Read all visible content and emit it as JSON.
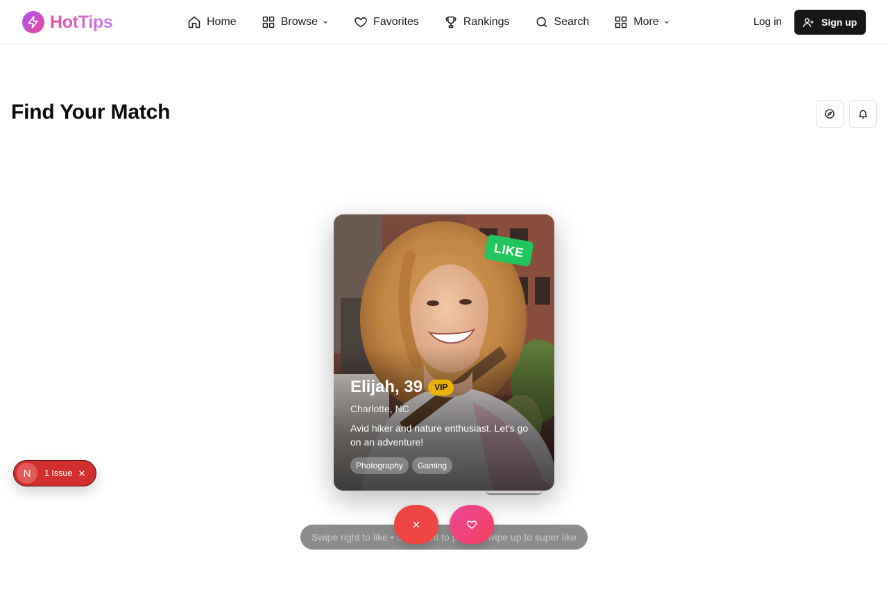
{
  "brand": {
    "name": "HotTips"
  },
  "nav": {
    "items": [
      {
        "label": "Home",
        "icon": "home-icon"
      },
      {
        "label": "Browse",
        "icon": "grid-icon"
      },
      {
        "label": "Favorites",
        "icon": "heart-icon"
      },
      {
        "label": "Rankings",
        "icon": "trophy-icon"
      },
      {
        "label": "Search",
        "icon": "search-icon"
      },
      {
        "label": "More",
        "icon": "grid-icon"
      }
    ]
  },
  "auth": {
    "login_label": "Log in",
    "signup_label": "Sign up"
  },
  "page": {
    "title": "Find Your Match"
  },
  "card": {
    "stamp": "LIKE",
    "name_age": "Elijah, 39",
    "badge": "VIP",
    "location": "Charlotte, NC",
    "bio": "Avid hiker and nature enthusiast. Let's go on an adventure!",
    "tags": [
      "Photography",
      "Gaming"
    ]
  },
  "hint": "Swipe right to like • Swipe left to pass • Swipe up to super like",
  "issue": {
    "badge": "N",
    "label": "1 Issue"
  },
  "colors": {
    "like_green": "#22c55e",
    "vip_gold": "#eab308",
    "pass_red": "#ef4444",
    "like_pink": "#ec4899",
    "issue_red": "#d32f2f",
    "signup_dark": "#171717"
  }
}
